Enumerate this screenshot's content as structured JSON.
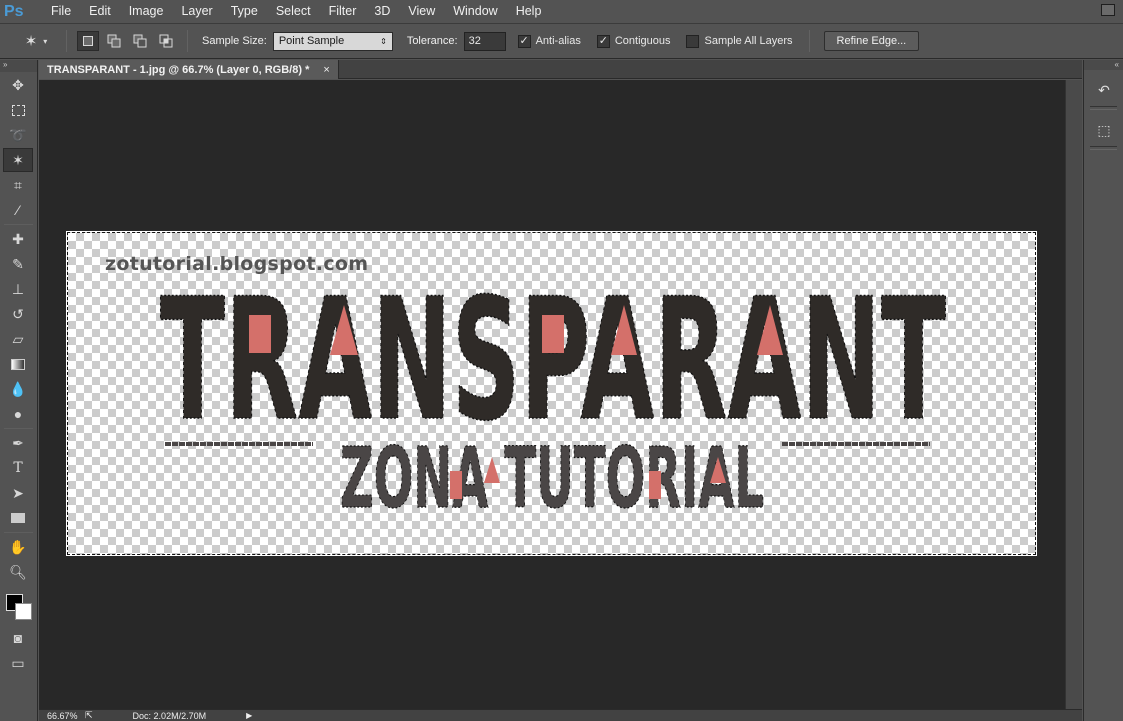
{
  "app": {
    "logo": "Ps"
  },
  "menu": [
    "File",
    "Edit",
    "Image",
    "Layer",
    "Type",
    "Select",
    "Filter",
    "3D",
    "View",
    "Window",
    "Help"
  ],
  "options": {
    "sample_size_label": "Sample Size:",
    "sample_size_value": "Point Sample",
    "tolerance_label": "Tolerance:",
    "tolerance_value": "32",
    "anti_alias_label": "Anti-alias",
    "anti_alias_checked": true,
    "contiguous_label": "Contiguous",
    "contiguous_checked": true,
    "sample_all_layers_label": "Sample All Layers",
    "sample_all_layers_checked": false,
    "refine_edge_label": "Refine Edge..."
  },
  "document": {
    "tab_title": "TRANSPARANT - 1.jpg @ 66.7% (Layer 0, RGB/8) *",
    "close": "×",
    "watermark": "zotutorial.blogspot.com",
    "headline": "TRANSPARANT",
    "subline": "ZONA TUTORIAL",
    "headline_color": "#2f2b28",
    "subline_color": "#4a4646",
    "accent_color": "#d4706a"
  },
  "status": {
    "zoom": "66.67%",
    "doc_info": "Doc: 2.02M/2.70M",
    "arrow": "▶"
  },
  "tools": [
    "move-icon",
    "marquee-icon",
    "lasso-icon",
    "magic-wand-icon",
    "crop-icon",
    "eyedropper-icon",
    "healing-brush-icon",
    "brush-icon",
    "clone-stamp-icon",
    "history-brush-icon",
    "eraser-icon",
    "gradient-icon",
    "blur-icon",
    "dodge-icon",
    "pen-icon",
    "type-icon",
    "path-selection-icon",
    "rectangle-icon",
    "hand-icon",
    "zoom-icon"
  ],
  "colors": {
    "foreground": "#000000",
    "background": "#ffffff",
    "selection_tool": "magic-wand"
  }
}
